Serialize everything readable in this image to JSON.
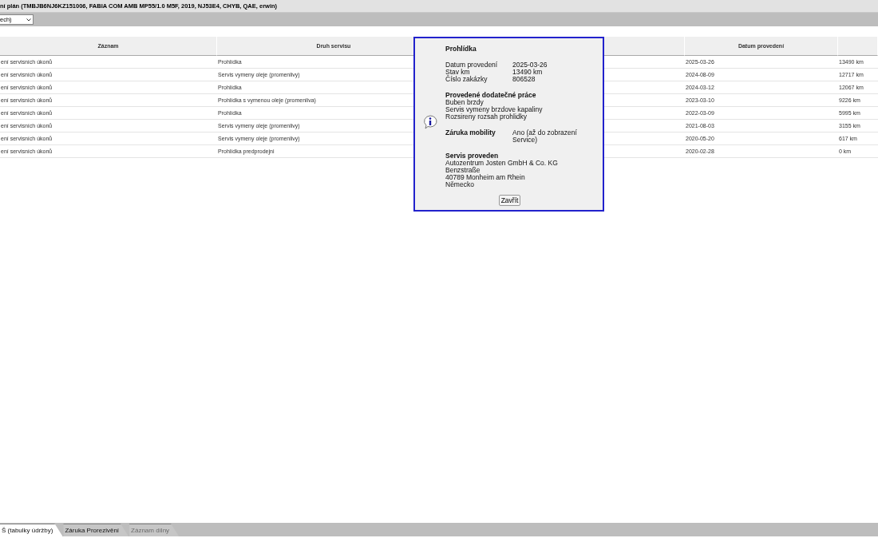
{
  "title": "ní plán (TMBJB6NJ6KZ151006, FABIA COM AMB MP55/1.0 M5F, 2019, NJ53E4, CHYB, QAE, erwin)",
  "filter": {
    "value": "ech)"
  },
  "table": {
    "columns": [
      "Záznam",
      "Druh servisu",
      "",
      "Datum provedení",
      ""
    ],
    "rows": [
      {
        "record": "ení servisních úkonů",
        "service": "Prohlídka",
        "date": "2025-03-26",
        "km": "13490 km"
      },
      {
        "record": "ení servisních úkonů",
        "service": "Servis vymeny oleje (promenlivy)",
        "date": "2024-08-09",
        "km": "12717 km"
      },
      {
        "record": "ení servisních úkonů",
        "service": "Prohlídka",
        "date": "2024-03-12",
        "km": "12067 km"
      },
      {
        "record": "ení servisních úkonů",
        "service": "Prohlídka s vymenou oleje (promenliva)",
        "date": "2023-03-10",
        "km": "9226 km"
      },
      {
        "record": "ení servisních úkonů",
        "service": "Prohlídka",
        "date": "2022-03-09",
        "km": "5995 km"
      },
      {
        "record": "ení servisních úkonů",
        "service": "Servis vymeny oleje (promenlivy)",
        "date": "2021-08-03",
        "km": "3155 km"
      },
      {
        "record": "ení servisních úkonů",
        "service": "Servis vymeny oleje (promenlivy)",
        "date": "2020-05-20",
        "km": "617 km"
      },
      {
        "record": "ení servisních úkonů",
        "service": "Prohlídka predprodejni",
        "date": "2020-02-28",
        "km": "0 km"
      }
    ]
  },
  "popup": {
    "heading": "Prohlídka",
    "facts": [
      {
        "label": "Datum provedení",
        "value": "2025-03-26"
      },
      {
        "label": "Stav km",
        "value": "13490 km"
      },
      {
        "label": "Číslo zakázky",
        "value": "806528"
      }
    ],
    "extra_heading": "Provedené dodatečné práce",
    "extra_items": [
      "Buben brzdy",
      "Servis vymeny brzdove kapaliny",
      "Rozsireny rozsah prohlidky"
    ],
    "mobility_label": "Záruka mobility",
    "mobility_value": "Ano (až do zobrazení Service)",
    "workshop_heading": "Servis proveden",
    "workshop_lines": [
      "Autozentrum Josten GmbH & Co. KG",
      "Benzstraße",
      "40789 Monheim am Rhein",
      "Německo"
    ],
    "close_button": "Zavřít"
  },
  "tabs": [
    {
      "label": "Š (tabulky údržby)",
      "selected": true,
      "disabled": false
    },
    {
      "label": "Záruka Prorezivění",
      "selected": false,
      "disabled": false
    },
    {
      "label": "Záznam dílny",
      "selected": false,
      "disabled": true
    }
  ]
}
